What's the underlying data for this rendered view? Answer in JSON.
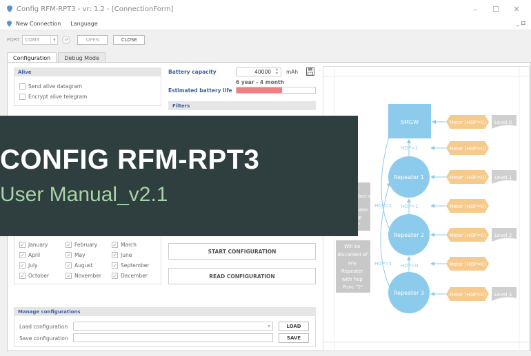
{
  "window": {
    "title": "Config RFM-RPT3 - vr: 1.2 - [ConnectionForm]",
    "minimize": "–",
    "maximize": "☐",
    "close": "✕"
  },
  "menu": {
    "items": [
      "New Connection",
      "Language"
    ],
    "mdi_controls": "_ ⊡"
  },
  "port": {
    "label": "PORT",
    "value": "COM3",
    "open_label": "OPEN",
    "close_label": "CLOSE"
  },
  "tabs": [
    "Configuration",
    "Debug Mode"
  ],
  "alive": {
    "header": "Alive",
    "send_alive": "Send alive datagram",
    "encrypt_alive": "Encrypt alive telegram"
  },
  "battery": {
    "capacity_label": "Battery capacity",
    "capacity_value": "40000",
    "unit": "mAh",
    "life_label": "Estimated battery life",
    "life_value": "6 year  - 4 month",
    "life_fraction": 0.58
  },
  "filters": {
    "header": "Filters"
  },
  "months": [
    "January",
    "February",
    "March",
    "April",
    "May",
    "June",
    "July",
    "August",
    "September",
    "October",
    "November",
    "December"
  ],
  "actions": {
    "start": "START CONFIGURATION",
    "read": "READ CONFIGURATION"
  },
  "manage": {
    "header": "Manage configurations",
    "load_label": "Load configuration",
    "save_label": "Save configuration",
    "load_btn": "LOAD",
    "save_btn": "SAVE"
  },
  "diagram": {
    "smgw": "SMGW",
    "repeaters": [
      "Repeater 1",
      "Repeater 2",
      "Repeater 3"
    ],
    "meter": "Meter (HOP=0)",
    "levels": [
      "Level 0",
      "Level 1",
      "Level 2",
      "Level 3"
    ],
    "hop_labels": [
      "HOP=1",
      "HOP=1",
      "HOP=1",
      "HOP=1",
      "HOP=0"
    ],
    "discard_note_1": [
      "e",
      "discarded of",
      "Repeater",
      "hop",
      "0\""
    ],
    "discard_note_2": [
      "Will be",
      "discarded of",
      "any",
      "Repeater",
      "with hop",
      "Func \"2\""
    ]
  },
  "overlay": {
    "title": "CONFIG RFM-RPT3",
    "subtitle": "User Manual_v2.1"
  },
  "colors": {
    "accent_blue": "#3a5fa0",
    "node_blue": "#8ccbec",
    "meter_orange": "#f6c98c",
    "level_gray": "#cfcfcf",
    "life_bar": "#f08080",
    "overlay_bg": "#2f3e3f",
    "overlay_sub": "#a8d4a8"
  }
}
